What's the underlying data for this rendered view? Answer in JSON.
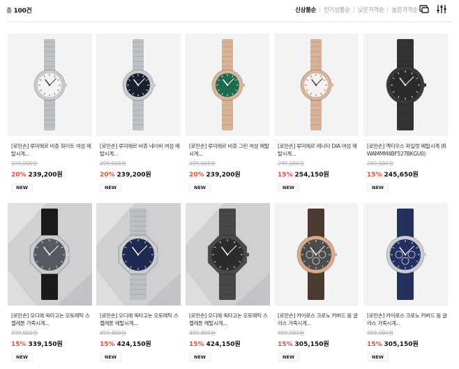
{
  "header": {
    "count_prefix": "총",
    "count_value": "100건",
    "sort_options": [
      "신상품순",
      "인기상품순",
      "낮은가격순",
      "높은가격순"
    ],
    "active_sort": 0,
    "view_icon": "view-toggle-icon",
    "filter_icon": "filter-icon"
  },
  "products": [
    {
      "name": "[로만손] 루미에르 비쥬 화이트 여성 메탈시계...",
      "original_price": "299,000원",
      "discount": "20%",
      "price": "239,200원",
      "badge": "NEW",
      "dial": "#f4f4f4",
      "case": "#c9cbce",
      "band": "#bfc2c5",
      "bg": "#f3f3f3",
      "style": "lady"
    },
    {
      "name": "[로만손] 루미에르 비쥬 네이비 여성 메탈시계...",
      "original_price": "299,000원",
      "discount": "20%",
      "price": "239,200원",
      "badge": "NEW",
      "dial": "#1b2030",
      "case": "#c9cbce",
      "band": "#bfc2c5",
      "bg": "#f3f3f3",
      "style": "lady"
    },
    {
      "name": "[로만손] 루미에르 비쥬 그린 여성 메탈시계...",
      "original_price": "299,000원",
      "discount": "20%",
      "price": "239,200원",
      "badge": "NEW",
      "dial": "#1f6b4e",
      "case": "#d9b49a",
      "band": "#d8b39a",
      "bg": "#f3f3f3",
      "style": "lady"
    },
    {
      "name": "[로만손] 루미에르 레니타 DIA 여성 메탈시계...",
      "original_price": "299,000원",
      "discount": "15%",
      "price": "254,150원",
      "badge": "NEW",
      "dial": "#f6f2ee",
      "case": "#d9b49a",
      "band": "#d8b39a",
      "bg": "#f3f3f3",
      "style": "lady"
    },
    {
      "name": "[로만손] 엑티우스 파일럿 메탈시계 (RWAMMM4BF527BKGU0)",
      "original_price": "289,000원",
      "discount": "15%",
      "price": "245,650원",
      "badge": "NEW",
      "dial": "#2a2a2a",
      "case": "#3a3a3a",
      "band": "#333333",
      "bg": "#f3f3f3",
      "style": "pilot"
    },
    {
      "name": "[로만손] 오디에 옥타고논 오토매틱 스켈레톤 가죽시계...",
      "original_price": "399,000원",
      "discount": "15%",
      "price": "339,150원",
      "badge": "NEW",
      "dial": "#555a60",
      "case": "#c9cbce",
      "band": "#1a1a1a",
      "bg": "#cfd0d2",
      "style": "octa"
    },
    {
      "name": "[로만손] 오디에 옥타고논 오토매틱 스켈레톤 메탈시계...",
      "original_price": "499,000원",
      "discount": "15%",
      "price": "424,150원",
      "badge": "NEW",
      "dial": "#1f2a52",
      "case": "#c9cbce",
      "band": "#bcbfc3",
      "bg": "#cfd0d2",
      "style": "octa"
    },
    {
      "name": "[로만손] 오디에 옥타고논 오토매틱 스켈레톤 메탈시계...",
      "original_price": "499,000원",
      "discount": "15%",
      "price": "424,150원",
      "badge": "NEW",
      "dial": "#2c2c2c",
      "case": "#4a4a4c",
      "band": "#48484a",
      "bg": "#cfd0d2",
      "style": "octa"
    },
    {
      "name": "[로만손] 카이로스 크로노 커버드 돔 글라스 가죽시계...",
      "original_price": "359,000원",
      "discount": "15%",
      "price": "305,150원",
      "badge": "NEW",
      "dial": "#4d4d4d",
      "case": "#d9a98a",
      "band": "#4a3a30",
      "bg": "#f3f3f3",
      "style": "chrono"
    },
    {
      "name": "[로만손] 카이로스 크로노 커버드 돔 글라스 가죽시계...",
      "original_price": "359,000원",
      "discount": "15%",
      "price": "305,150원",
      "badge": "NEW",
      "dial": "#223064",
      "case": "#c9cbce",
      "band": "#24305e",
      "bg": "#f3f3f3",
      "style": "chrono"
    }
  ]
}
